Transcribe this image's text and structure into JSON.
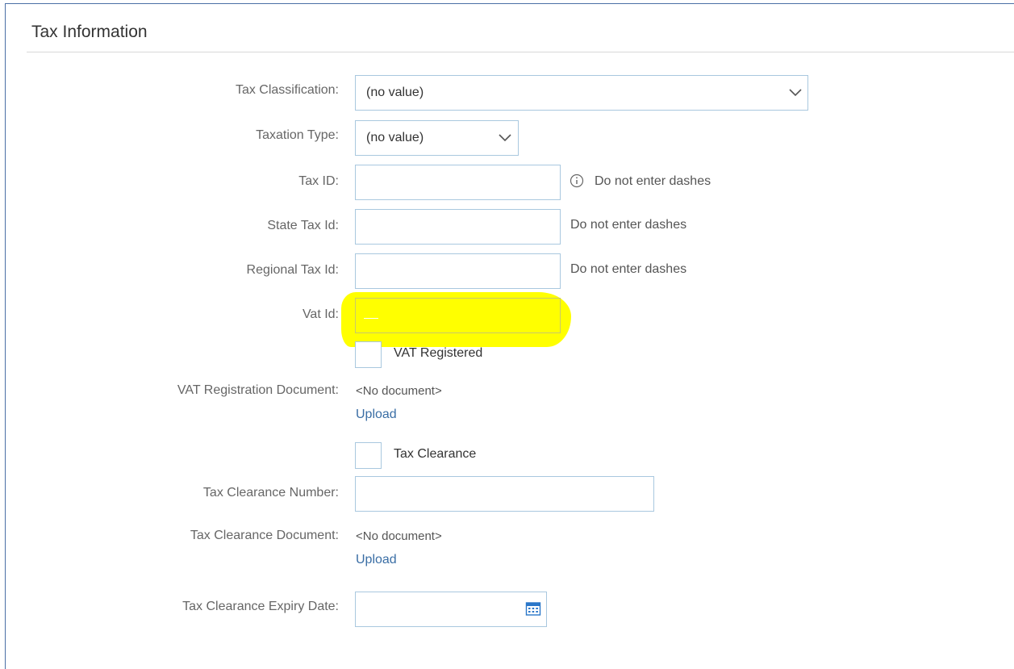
{
  "section": {
    "title": "Tax Information"
  },
  "fields": {
    "tax_classification": {
      "label": "Tax Classification:",
      "value": "(no value)"
    },
    "taxation_type": {
      "label": "Taxation Type:",
      "value": "(no value)"
    },
    "tax_id": {
      "label": "Tax ID:",
      "value": "",
      "hint": "Do not enter dashes"
    },
    "state_tax_id": {
      "label": "State Tax Id:",
      "value": "",
      "hint": "Do not enter dashes"
    },
    "regional_tax_id": {
      "label": "Regional Tax Id:",
      "value": "",
      "hint": "Do not enter dashes"
    },
    "vat_id": {
      "label": "Vat Id:",
      "value": ""
    },
    "vat_registered": {
      "label": "VAT Registered",
      "checked": false
    },
    "vat_registration_document": {
      "label": "VAT Registration Document:",
      "value": "<No document>",
      "action": "Upload"
    },
    "tax_clearance": {
      "label": "Tax Clearance",
      "checked": false
    },
    "tax_clearance_number": {
      "label": "Tax Clearance Number:",
      "value": ""
    },
    "tax_clearance_document": {
      "label": "Tax Clearance Document:",
      "value": "<No document>",
      "action": "Upload"
    },
    "tax_clearance_expiry_date": {
      "label": "Tax Clearance Expiry Date:",
      "value": ""
    }
  },
  "icons": {
    "select_chevron": "chevron-down-icon",
    "info": "info-icon",
    "calendar": "calendar-icon"
  },
  "colors": {
    "field_border": "#a9c8df",
    "link": "#3a6ea5",
    "highlight": "#ffff00"
  }
}
